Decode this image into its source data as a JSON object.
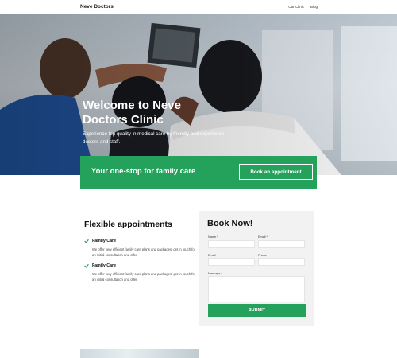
{
  "header": {
    "logo": "Neve Doctors",
    "nav": [
      "Our Clinic",
      "Blog"
    ]
  },
  "hero": {
    "title": "Welcome to Neve Doctors Clinic",
    "subtitle": "Experience top quality in medical care by friendly and experience doctors and staff."
  },
  "cta": {
    "text": "Your one-stop for family care",
    "button": "Book an appointment"
  },
  "appointments": {
    "title": "Flexible appointments",
    "items": [
      {
        "title": "Family Care",
        "description": "We offer very efficient family care plans and packages, get in touch for an initial consultation and offer."
      },
      {
        "title": "Family Care",
        "description": "We offer very efficient family care plans and packages, get in touch for an initial consultation and offer."
      }
    ]
  },
  "booking": {
    "title": "Book Now!",
    "name_label": "Name *",
    "email_label": "Email *",
    "name_value": "",
    "email_value": "",
    "emailfield_label": "Email",
    "phone_label": "Phone",
    "message_label": "Message *",
    "submit": "SUBMIT"
  },
  "colors": {
    "accent": "#24a15b",
    "card_bg": "#f2f2f2"
  }
}
